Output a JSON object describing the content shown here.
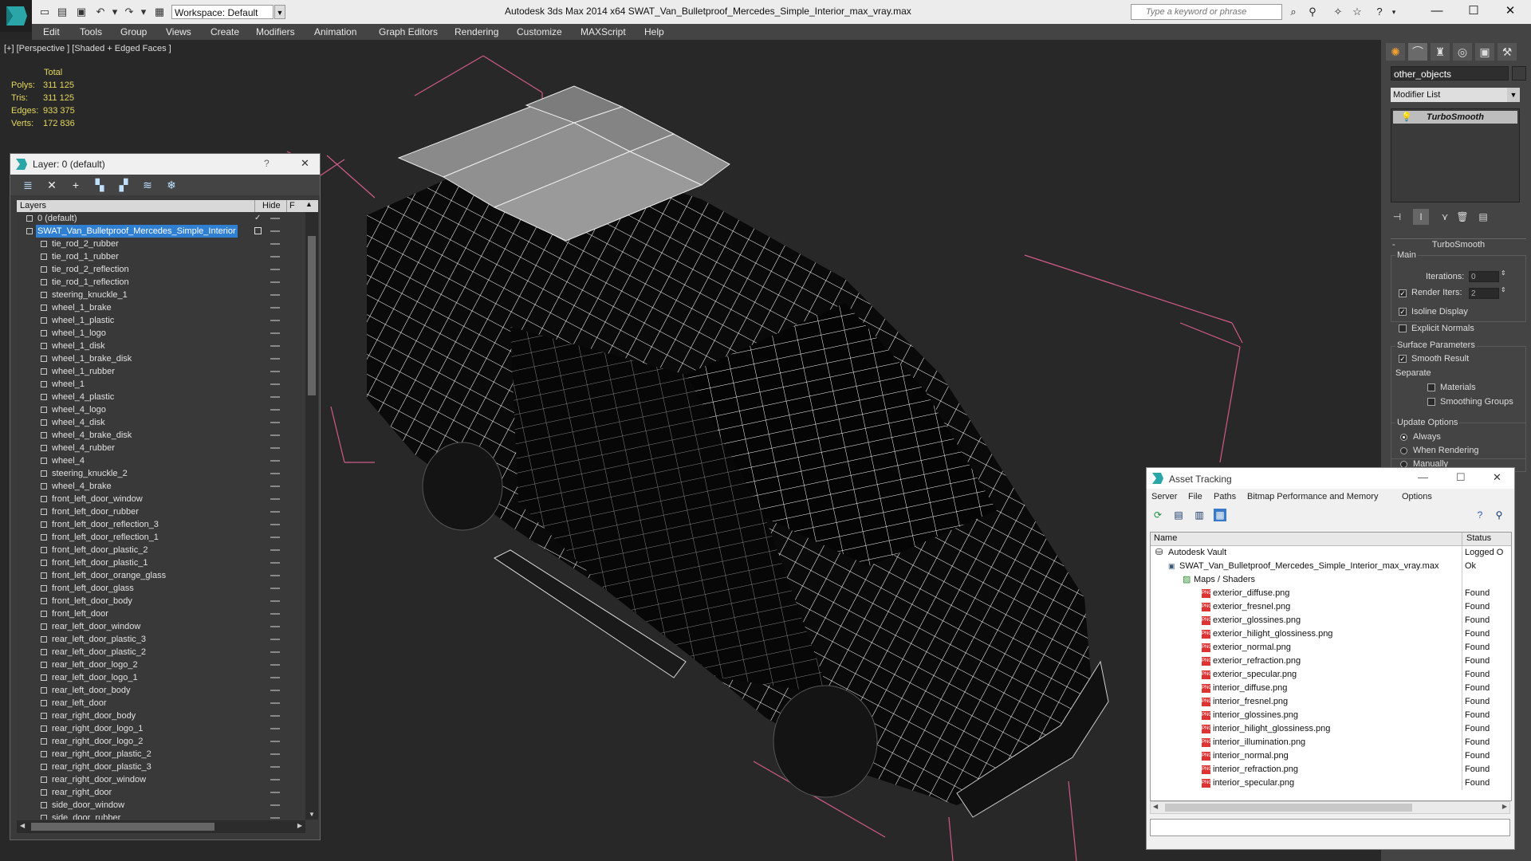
{
  "window": {
    "title": "Autodesk 3ds Max 2014 x64      SWAT_Van_Bulletproof_Mercedes_Simple_Interior_max_vray.max",
    "workspace": "Workspace: Default",
    "search_placeholder": "Type a keyword or phrase"
  },
  "menu": [
    "Edit",
    "Tools",
    "Group",
    "Views",
    "Create",
    "Modifiers",
    "Animation",
    "Graph Editors",
    "Rendering",
    "Customize",
    "MAXScript",
    "Help"
  ],
  "viewport": {
    "label": "[+] [Perspective ] [Shaded + Edged Faces ]",
    "stats": {
      "title": "Total",
      "rows": [
        {
          "label": "Polys:",
          "value": "311 125"
        },
        {
          "label": "Tris:",
          "value": "311 125"
        },
        {
          "label": "Edges:",
          "value": "933 375"
        },
        {
          "label": "Verts:",
          "value": "172 836"
        }
      ]
    }
  },
  "layer_dialog": {
    "title": "Layer: 0 (default)",
    "help": "?",
    "close": "✕",
    "col_layers": "Layers",
    "col_hide": "Hide",
    "col_f": "F",
    "rows": [
      "0 (default)",
      "SWAT_Van_Bulletproof_Mercedes_Simple_Interior",
      "tie_rod_2_rubber",
      "tie_rod_1_rubber",
      "tie_rod_2_reflection",
      "tie_rod_1_reflection",
      "steering_knuckle_1",
      "wheel_1_brake",
      "wheel_1_plastic",
      "wheel_1_logo",
      "wheel_1_disk",
      "wheel_1_brake_disk",
      "wheel_1_rubber",
      "wheel_1",
      "wheel_4_plastic",
      "wheel_4_logo",
      "wheel_4_disk",
      "wheel_4_brake_disk",
      "wheel_4_rubber",
      "wheel_4",
      "steering_knuckle_2",
      "wheel_4_brake",
      "front_left_door_window",
      "front_left_door_rubber",
      "front_left_door_reflection_3",
      "front_left_door_reflection_1",
      "front_left_door_plastic_2",
      "front_left_door_plastic_1",
      "front_left_door_orange_glass",
      "front_left_door_glass",
      "front_left_door_body",
      "front_left_door",
      "rear_left_door_window",
      "rear_left_door_plastic_3",
      "rear_left_door_plastic_2",
      "rear_left_door_logo_2",
      "rear_left_door_logo_1",
      "rear_left_door_body",
      "rear_left_door",
      "rear_right_door_body",
      "rear_right_door_logo_1",
      "rear_right_door_logo_2",
      "rear_right_door_plastic_2",
      "rear_right_door_plastic_3",
      "rear_right_door_window",
      "rear_right_door",
      "side_door_window",
      "side_door_rubber"
    ]
  },
  "command_panel": {
    "object_name": "other_objects",
    "modifier_list": "Modifier List",
    "stack_item": "TurboSmooth",
    "rollout_title": "TurboSmooth",
    "main_label": "Main",
    "iterations_label": "Iterations:",
    "iterations_value": "0",
    "render_iters_label": "Render Iters:",
    "render_iters_value": "2",
    "isoline_display": "Isoline Display",
    "explicit_normals": "Explicit Normals",
    "surface_params": "Surface Parameters",
    "smooth_result": "Smooth Result",
    "separate": "Separate",
    "materials": "Materials",
    "smoothing_groups": "Smoothing Groups",
    "update_options": "Update Options",
    "always": "Always",
    "when_rendering": "When Rendering",
    "manually": "Manually"
  },
  "asset_tracking": {
    "title": "Asset Tracking",
    "menu": [
      "Server",
      "File",
      "Paths",
      "Bitmap Performance and Memory",
      "Options"
    ],
    "col_name": "Name",
    "col_status": "Status",
    "vault": {
      "name": "Autodesk Vault",
      "status": "Logged O"
    },
    "max_file": {
      "name": "SWAT_Van_Bulletproof_Mercedes_Simple_Interior_max_vray.max",
      "status": "Ok"
    },
    "maps_group": "Maps / Shaders",
    "files": [
      {
        "name": "exterior_diffuse.png",
        "status": "Found"
      },
      {
        "name": "exterior_fresnel.png",
        "status": "Found"
      },
      {
        "name": "exterior_glossines.png",
        "status": "Found"
      },
      {
        "name": "exterior_hilight_glossiness.png",
        "status": "Found"
      },
      {
        "name": "exterior_normal.png",
        "status": "Found"
      },
      {
        "name": "exterior_refraction.png",
        "status": "Found"
      },
      {
        "name": "exterior_specular.png",
        "status": "Found"
      },
      {
        "name": "interior_diffuse.png",
        "status": "Found"
      },
      {
        "name": "interior_fresnel.png",
        "status": "Found"
      },
      {
        "name": "interior_glossines.png",
        "status": "Found"
      },
      {
        "name": "interior_hilight_glossiness.png",
        "status": "Found"
      },
      {
        "name": "interior_illumination.png",
        "status": "Found"
      },
      {
        "name": "interior_normal.png",
        "status": "Found"
      },
      {
        "name": "interior_refraction.png",
        "status": "Found"
      },
      {
        "name": "interior_specular.png",
        "status": "Found"
      }
    ]
  }
}
